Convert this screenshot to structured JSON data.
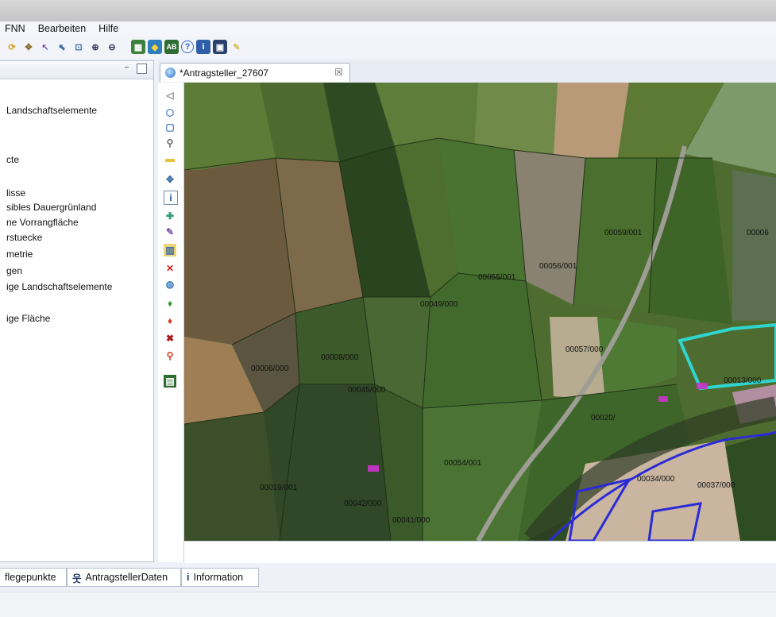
{
  "menubar": {
    "items": [
      "FNN",
      "Bearbeiten",
      "Hilfe"
    ]
  },
  "toolbar": {
    "icons": [
      "refresh-icon",
      "tools-icon",
      "pointer-icon",
      "select-icon",
      "zoom-box-icon",
      "zoom-in-icon",
      "zoom-out-icon",
      "map-view-icon",
      "layer-icon",
      "ab-icon",
      "help-icon",
      "info-book-icon",
      "save-icon",
      "edit-pencil-icon"
    ]
  },
  "left_panel": {
    "tree_items": [
      "Landschaftselemente",
      "cte",
      "lisse",
      "sibles Dauergrünland",
      "ne Vorrangfläche",
      "rstuecke",
      "metrie",
      "gen",
      "ige Landschaftselemente",
      "ige Fläche"
    ]
  },
  "editor": {
    "tab_title": "*Antragsteller_27607",
    "close_glyph": "☒"
  },
  "map": {
    "parcels": [
      "00059/001",
      "00056/001",
      "00055/001",
      "00049/000",
      "00008/000",
      "00006/000",
      "00045/000",
      "00057/000",
      "00013/000",
      "00020/",
      "00054/001",
      "00034/000",
      "00037/000",
      "00019/001",
      "00042/000",
      "00041/000",
      "00006"
    ],
    "highlight_color": "#2fd6d0",
    "boundary_color": "#2b2bd6"
  },
  "bottom_tabs": [
    {
      "icon": "",
      "label": "flegepunkte"
    },
    {
      "icon": "person-icon",
      "label": "AntragstellerDaten"
    },
    {
      "icon": "info-icon",
      "label": "Information"
    }
  ]
}
